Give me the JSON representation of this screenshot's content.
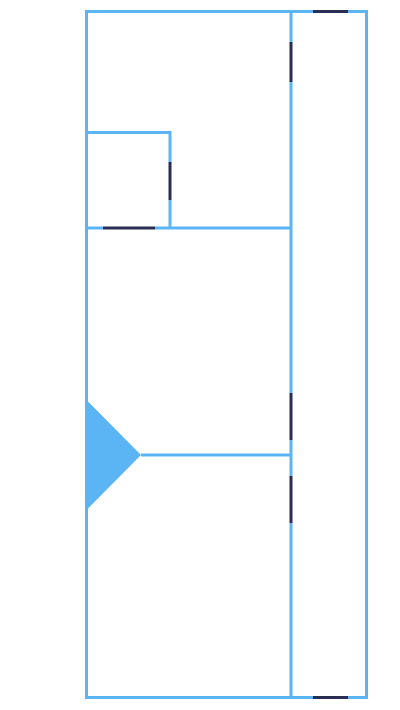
{
  "colors": {
    "wall": "#5bb4f4",
    "door": "#2a2e52",
    "background": "#ffffff"
  },
  "floorplan": {
    "rooms": [
      "room-top-main",
      "room-closet",
      "room-middle",
      "room-bottom",
      "room-corridor"
    ],
    "doors": 7,
    "entrance_marker": "arrow-triangle"
  }
}
